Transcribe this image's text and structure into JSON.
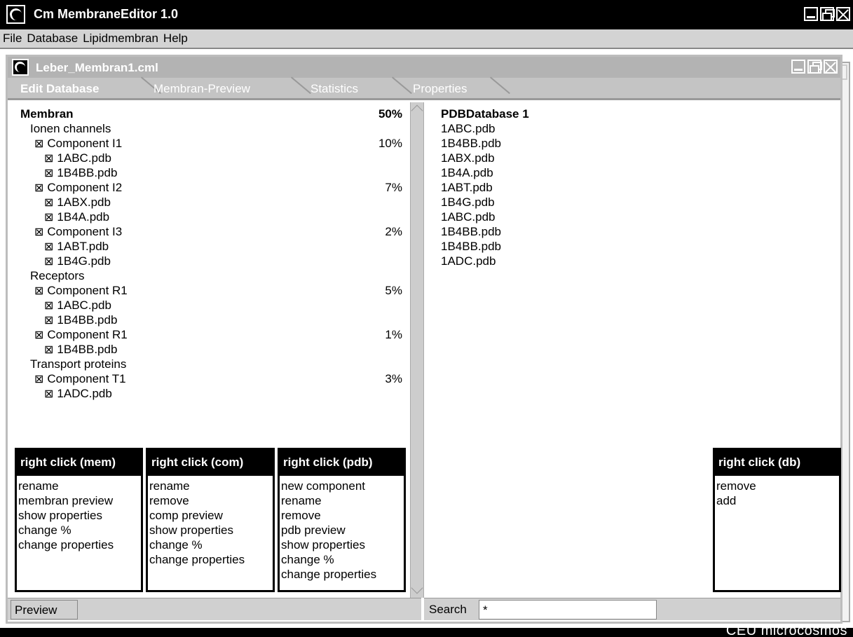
{
  "app": {
    "title": "Cm MembraneEditor 1.0"
  },
  "menu": [
    "File",
    "Database",
    "Lipidmembran",
    "Help"
  ],
  "document": {
    "title": "Leber_Membran1.cml"
  },
  "tabs": [
    "Edit Database",
    "Membran-Preview",
    "Statistics",
    "Properties"
  ],
  "tree": [
    {
      "label": "Membran",
      "pct": "50%",
      "level": 0,
      "checkbox": false
    },
    {
      "label": "Ionen channels",
      "pct": "",
      "level": 1,
      "checkbox": false
    },
    {
      "label": "Component I1",
      "pct": "10%",
      "level": 2,
      "checkbox": true
    },
    {
      "label": "1ABC.pdb",
      "pct": "",
      "level": 3,
      "checkbox": true
    },
    {
      "label": "1B4BB.pdb",
      "pct": "",
      "level": 3,
      "checkbox": true
    },
    {
      "label": "Component I2",
      "pct": "7%",
      "level": 2,
      "checkbox": true
    },
    {
      "label": "1ABX.pdb",
      "pct": "",
      "level": 3,
      "checkbox": true
    },
    {
      "label": "1B4A.pdb",
      "pct": "",
      "level": 3,
      "checkbox": true
    },
    {
      "label": "Component I3",
      "pct": "2%",
      "level": 2,
      "checkbox": true
    },
    {
      "label": "1ABT.pdb",
      "pct": "",
      "level": 3,
      "checkbox": true
    },
    {
      "label": "1B4G.pdb",
      "pct": "",
      "level": 3,
      "checkbox": true
    },
    {
      "label": "Receptors",
      "pct": "",
      "level": 1,
      "checkbox": false
    },
    {
      "label": "Component R1",
      "pct": "5%",
      "level": 2,
      "checkbox": true
    },
    {
      "label": "1ABC.pdb",
      "pct": "",
      "level": 3,
      "checkbox": true
    },
    {
      "label": "1B4BB.pdb",
      "pct": "",
      "level": 3,
      "checkbox": true
    },
    {
      "label": "Component R1",
      "pct": "1%",
      "level": 2,
      "checkbox": true
    },
    {
      "label": "1B4BB.pdb",
      "pct": "",
      "level": 3,
      "checkbox": true
    },
    {
      "label": "Transport proteins",
      "pct": "",
      "level": 1,
      "checkbox": false
    },
    {
      "label": "Component T1",
      "pct": "3%",
      "level": 2,
      "checkbox": true
    },
    {
      "label": "1ADC.pdb",
      "pct": "",
      "level": 3,
      "checkbox": true
    }
  ],
  "checkbox_glyph": "⊠",
  "database": {
    "title": "PDBDatabase 1",
    "items": [
      "1ABC.pdb",
      "1B4BB.pdb",
      "1ABX.pdb",
      "1B4A.pdb",
      "1ABT.pdb",
      "1B4G.pdb",
      "1ABC.pdb",
      "1B4BB.pdb",
      "1B4BB.pdb",
      "1ADC.pdb"
    ]
  },
  "context_menus": {
    "mem": {
      "title": "right click (mem)",
      "items": [
        "rename",
        "membran preview",
        "show properties",
        "change %",
        "change properties"
      ]
    },
    "com": {
      "title": "right click (com)",
      "items": [
        "rename",
        "remove",
        "comp preview",
        "show properties",
        "change %",
        "change properties"
      ]
    },
    "pdb": {
      "title": "right click (pdb)",
      "items": [
        "new component",
        "rename",
        "remove",
        "pdb preview",
        "show properties",
        "change %",
        "change properties"
      ]
    },
    "db": {
      "title": "right click (db)",
      "items": [
        "remove",
        "add"
      ]
    }
  },
  "status": {
    "preview_label": "Preview",
    "search_label": "Search",
    "search_value": "*"
  },
  "logo": "CEU microcosmos"
}
